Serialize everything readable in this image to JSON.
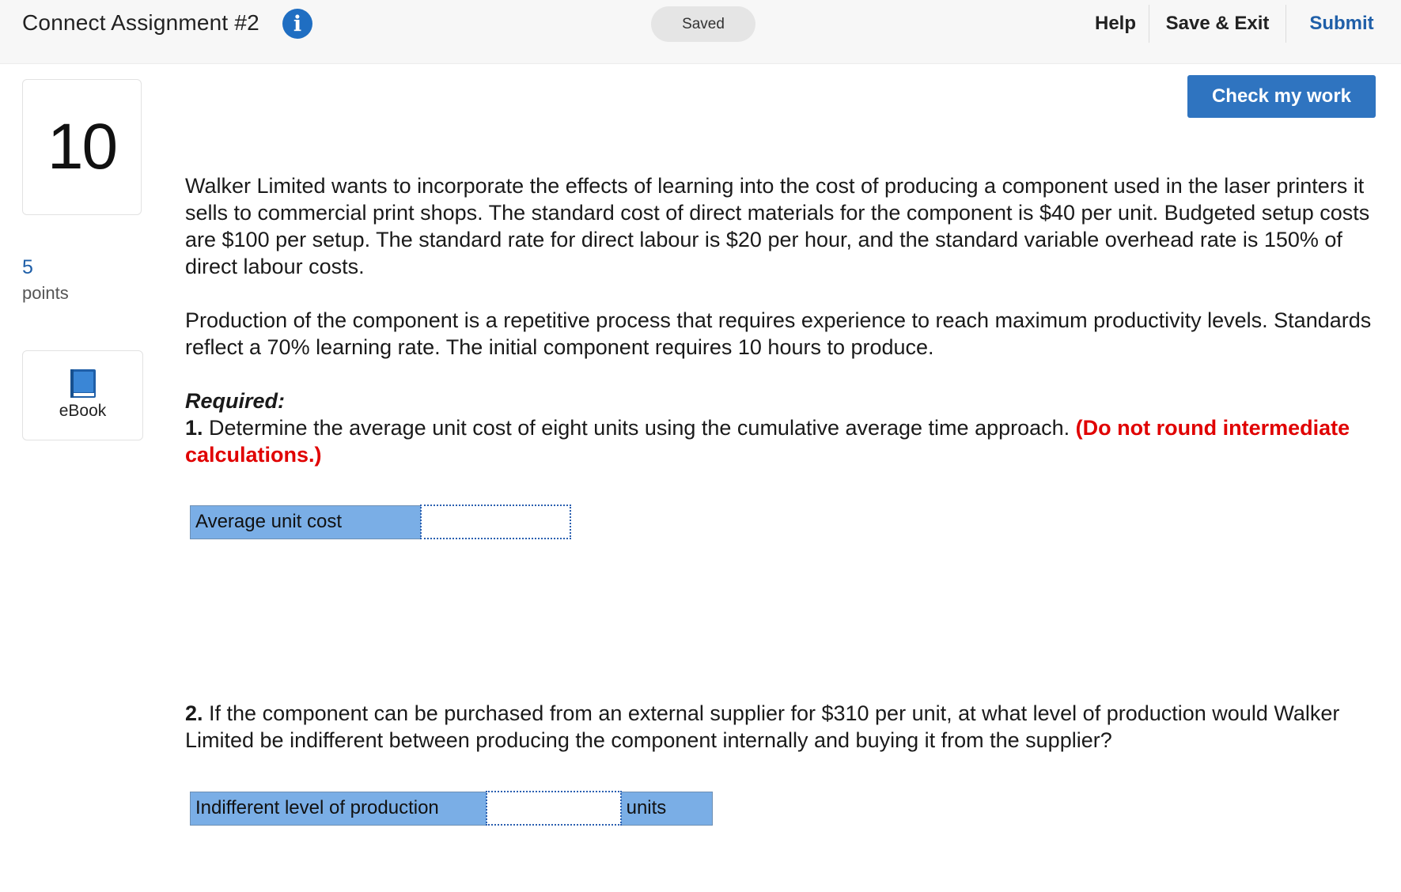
{
  "header": {
    "title": "Connect Assignment #2",
    "info_icon": "info-icon",
    "saved_status": "Saved",
    "help_label": "Help",
    "save_exit_label": "Save & Exit",
    "submit_label": "Submit"
  },
  "sidebar": {
    "question_number": "10",
    "points_value": "5",
    "points_label": "points",
    "ebook_label": "eBook",
    "ebook_icon": "book-icon"
  },
  "check_my_work_label": "Check my work",
  "question": {
    "paragraph1": "Walker Limited wants to incorporate the effects of learning into the cost of producing a component used in the laser printers it sells to commercial print shops. The standard cost of direct materials for the component is $40 per unit. Budgeted setup costs are $100 per setup. The standard rate for direct labour is $20 per hour, and the standard variable overhead rate is 150% of direct labour costs.",
    "paragraph2": "Production of the component is a repetitive process that requires experience to reach maximum productivity levels. Standards reflect a 70% learning rate. The initial component requires 10 hours to produce.",
    "required_title": "Required:",
    "part1_number": "1.",
    "part1_text": " Determine the average unit cost of eight units using the cumulative average time approach. ",
    "part1_note": "(Do not round intermediate calculations.)",
    "part2_number": "2.",
    "part2_text": " If the component can be purchased from an external supplier for $310 per unit, at what level of production would Walker Limited be indifferent between producing the component internally and buying it from the supplier?"
  },
  "answers": {
    "row1": {
      "label": "Average unit cost",
      "value": ""
    },
    "row2": {
      "label": "Indifferent level of production",
      "value": "",
      "unit": "units"
    }
  },
  "colors": {
    "accent_blue": "#2f74c0",
    "link_blue": "#1f5fa8",
    "table_blue": "#7aaee6",
    "warning_red": "#e00000"
  }
}
